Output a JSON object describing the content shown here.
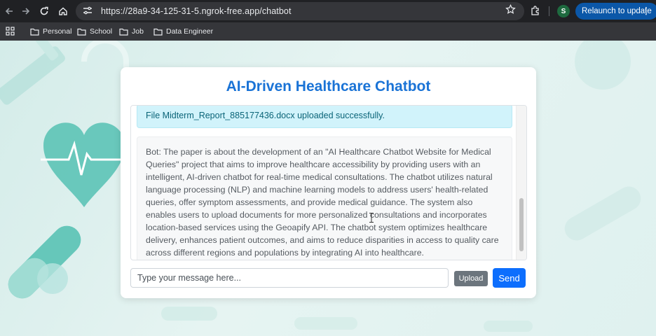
{
  "browser": {
    "url": "https://28a9-34-125-31-5.ngrok-free.app/chatbot",
    "profile_initial": "S",
    "relaunch_label": "Relaunch to update",
    "bookmarks": [
      "Personal",
      "School",
      "Job",
      "Data Engineer"
    ],
    "icons": [
      "back-icon",
      "forward-icon",
      "reload-icon",
      "home-icon",
      "site-settings-icon",
      "star-icon",
      "extensions-icon",
      "apps-grid-icon",
      "folder-icon",
      "more-icon"
    ]
  },
  "app": {
    "title": "AI-Driven Healthcare Chatbot",
    "messages": [
      {
        "type": "upload",
        "text": "File Midterm_Report_885177436.docx uploaded successfully."
      },
      {
        "type": "bot",
        "text": "Bot: The paper is about the development of an \"AI Healthcare Chatbot Website for Medical Queries\" project that aims to improve healthcare accessibility by providing users with an intelligent, AI-driven chatbot for real-time medical consultations. The chatbot utilizes natural language processing (NLP) and machine learning models to address users' health-related queries, offer symptom assessments, and provide medical guidance. The system also enables users to upload documents for more personalized consultations and incorporates location-based services using the Geoapify API. The chatbot system optimizes healthcare delivery, enhances patient outcomes, and aims to reduce disparities in access to quality care across different regions and populations by integrating AI into healthcare."
      }
    ],
    "input_placeholder": "Type your message here...",
    "upload_label": "Upload",
    "send_label": "Send"
  },
  "colors": {
    "title": "#1a73d6",
    "upload_alert_bg": "#d1f3fb",
    "upload_button": "#6c757d",
    "send_button": "#0d6efd",
    "relaunch_button": "#0b57a8",
    "page_bg": "#dff1ef"
  }
}
